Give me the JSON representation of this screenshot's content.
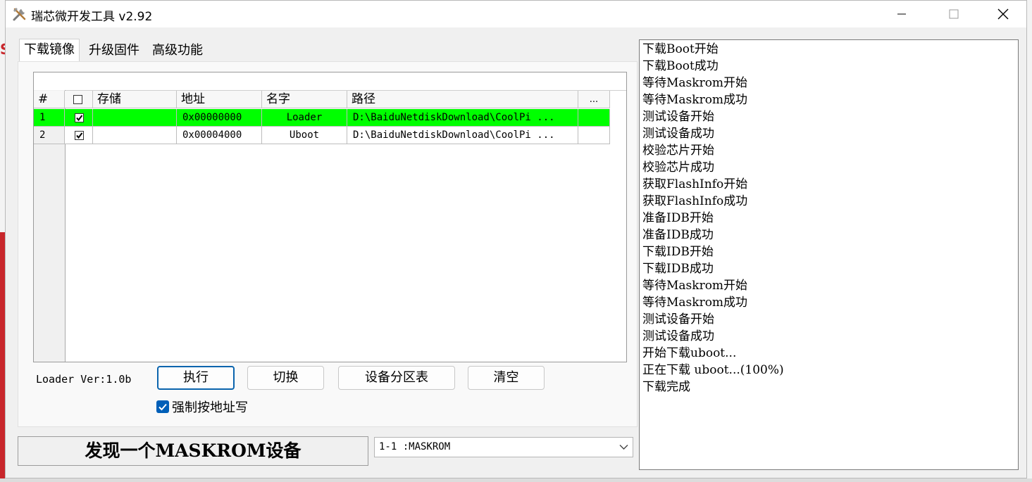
{
  "window": {
    "title": "瑞芯微开发工具 v2.92"
  },
  "tabs": [
    "下载镜像",
    "升级固件",
    "高级功能"
  ],
  "table": {
    "headers": [
      "#",
      "存储",
      "地址",
      "名字",
      "路径",
      "..."
    ],
    "rows": [
      {
        "index": "1",
        "checked": true,
        "storage": "",
        "address": "0x00000000",
        "name": "Loader",
        "path": "D:\\BaiduNetdiskDownload\\CoolPi ...",
        "highlighted": true
      },
      {
        "index": "2",
        "checked": true,
        "storage": "",
        "address": "0x00004000",
        "name": "Uboot",
        "path": "D:\\BaiduNetdiskDownload\\CoolPi ...",
        "highlighted": false
      }
    ]
  },
  "loader_version": "Loader Ver:1.0b",
  "buttons": {
    "execute": "执行",
    "switch": "切换",
    "partition_table": "设备分区表",
    "clear": "清空"
  },
  "force_address_write": {
    "label": "强制按地址写",
    "checked": true
  },
  "status_text": "发现一个MASKROM设备",
  "device_select": {
    "value": "1-1 :MASKROM"
  },
  "log_lines": [
    "下载Boot开始",
    "下载Boot成功",
    "等待Maskrom开始",
    "等待Maskrom成功",
    "测试设备开始",
    "测试设备成功",
    "校验芯片开始",
    "校验芯片成功",
    "获取FlashInfo开始",
    "获取FlashInfo成功",
    "准备IDB开始",
    "准备IDB成功",
    "下载IDB开始",
    "下载IDB成功",
    "等待Maskrom开始",
    "等待Maskrom成功",
    "测试设备开始",
    "测试设备成功",
    "开始下载uboot...",
    "正在下载 uboot...(100%)",
    "下载完成"
  ],
  "colors": {
    "highlight_row": "#00ff00",
    "accent": "#005fb8"
  }
}
